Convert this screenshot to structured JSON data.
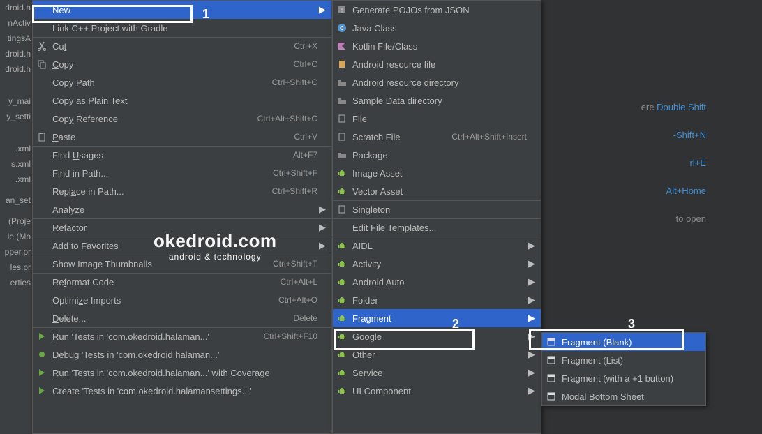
{
  "background": {
    "files": [
      "droid.h",
      "nActiv",
      "tingsA",
      "droid.h",
      "droid.h",
      "",
      "",
      "",
      "y_mai",
      "y_setti",
      "",
      "",
      "",
      ".xml",
      "s.xml",
      ".xml",
      "",
      "an_set",
      "",
      " (Proje",
      "le (Mo",
      "pper.pr",
      "les.pr",
      "erties"
    ],
    "hints": {
      "h1_pre": "ere ",
      "h1_blue": "Double Shift",
      "h2_blue": "-Shift+N",
      "h3_blue": "rl+E",
      "h4_blue": "Alt+Home",
      "h5_pre": "to open"
    }
  },
  "menu": {
    "main": [
      {
        "label": "New",
        "arrow": true,
        "highlight": true
      },
      {
        "label": "Link C++ Project with Gradle",
        "sep": true
      },
      {
        "icon": "cut",
        "label": "Cu<u>t</u>",
        "shortcut": "Ctrl+X"
      },
      {
        "icon": "copy",
        "label": "<u>C</u>opy",
        "shortcut": "Ctrl+C"
      },
      {
        "label": "Copy Path",
        "shortcut": "Ctrl+Shift+C"
      },
      {
        "label": "Copy as Plain Text"
      },
      {
        "label": "Cop<u>y</u> Reference",
        "shortcut": "Ctrl+Alt+Shift+C"
      },
      {
        "icon": "paste",
        "label": "<u>P</u>aste",
        "shortcut": "Ctrl+V",
        "sep": true
      },
      {
        "label": "Find <u>U</u>sages",
        "shortcut": "Alt+F7"
      },
      {
        "label": "Find in Path...",
        "shortcut": "Ctrl+Shift+F"
      },
      {
        "label": "Repl<u>a</u>ce in Path...",
        "shortcut": "Ctrl+Shift+R"
      },
      {
        "label": "Analy<u>z</u>e",
        "arrow": true,
        "sep": true
      },
      {
        "label": "<u>R</u>efactor",
        "arrow": true,
        "sep": true
      },
      {
        "label": "Add to F<u>a</u>vorites",
        "arrow": true,
        "sep": true
      },
      {
        "label": "Show Image Thumbnails",
        "shortcut": "Ctrl+Shift+T",
        "sep": true
      },
      {
        "label": "Re<u>f</u>ormat Code",
        "shortcut": "Ctrl+Alt+L"
      },
      {
        "label": "Optimi<u>z</u>e Imports",
        "shortcut": "Ctrl+Alt+O"
      },
      {
        "label": "<u>D</u>elete...",
        "shortcut": "Delete",
        "sep": true
      },
      {
        "icon": "run",
        "label": "<u>R</u>un 'Tests in 'com.okedroid.halaman...'",
        "shortcut": "Ctrl+Shift+F10"
      },
      {
        "icon": "debug",
        "label": "<u>D</u>ebug 'Tests in 'com.okedroid.halaman...'"
      },
      {
        "icon": "run-cov",
        "label": "R<u>u</u>n 'Tests in 'com.okedroid.halaman...' with Cover<u>a</u>ge"
      },
      {
        "icon": "run",
        "label": "Create 'Tests in 'com.okedroid.halamansettings...'"
      }
    ],
    "sub1": [
      {
        "icon": "json",
        "label": "Generate POJOs from JSON"
      },
      {
        "icon": "java",
        "label": "Java Class"
      },
      {
        "icon": "kotlin",
        "label": "Kotlin File/Class"
      },
      {
        "icon": "file-a",
        "label": "Android resource file"
      },
      {
        "icon": "folder",
        "label": "Android resource directory"
      },
      {
        "icon": "folder",
        "label": "Sample Data directory"
      },
      {
        "icon": "file",
        "label": "File"
      },
      {
        "icon": "file",
        "label": "Scratch File",
        "shortcut": "Ctrl+Alt+Shift+Insert"
      },
      {
        "icon": "folder",
        "label": "Package"
      },
      {
        "icon": "android",
        "label": "Image Asset"
      },
      {
        "icon": "android",
        "label": "Vector Asset",
        "sep": true
      },
      {
        "icon": "file-s",
        "label": "Singleton",
        "sep": true
      },
      {
        "label": "Edit File Templates...",
        "sep": true
      },
      {
        "icon": "android",
        "label": "AIDL",
        "arrow": true
      },
      {
        "icon": "android",
        "label": "Activity",
        "arrow": true
      },
      {
        "icon": "android",
        "label": "Android Auto",
        "arrow": true
      },
      {
        "icon": "android",
        "label": "Folder",
        "arrow": true
      },
      {
        "icon": "android",
        "label": "Fragment",
        "arrow": true,
        "highlight": true
      },
      {
        "icon": "android",
        "label": "Google",
        "arrow": true
      },
      {
        "icon": "android",
        "label": "Other",
        "arrow": true
      },
      {
        "icon": "android",
        "label": "Service",
        "arrow": true
      },
      {
        "icon": "android",
        "label": "UI Component",
        "arrow": true
      }
    ],
    "sub2": [
      {
        "icon": "frag",
        "label": "Fragment (Blank)",
        "highlight": true
      },
      {
        "icon": "frag",
        "label": "Fragment (List)"
      },
      {
        "icon": "frag",
        "label": "Fragment (with a +1 button)"
      },
      {
        "icon": "frag",
        "label": "Modal Bottom Sheet"
      }
    ]
  },
  "watermark": {
    "big": "okedroid.com",
    "small": "android & technology"
  },
  "annotations": {
    "n1": "1",
    "n2": "2",
    "n3": "3"
  }
}
